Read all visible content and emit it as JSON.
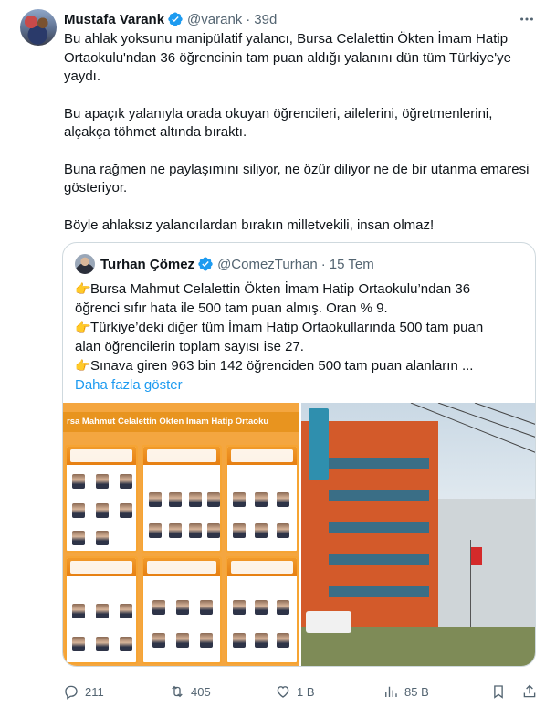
{
  "tweet": {
    "author_name": "Mustafa Varank",
    "handle": "@varank",
    "separator": "·",
    "time": "39d",
    "paragraphs": [
      "Bu ahlak yoksunu manipülatif yalancı,  Bursa Celalettin Ökten İmam Hatip Ortaokulu'ndan 36 öğrencinin tam puan aldığı yalanını dün tüm Türkiye'ye yaydı.",
      "Bu apaçık yalanıyla orada okuyan öğrencileri, ailelerini, öğretmenlerini, alçakça töhmet altında bıraktı.",
      "Buna rağmen ne paylaşımını siliyor, ne özür diliyor ne de bir utanma emaresi gösteriyor.",
      "Böyle ahlaksız yalancılardan bırakın milletvekili, insan olmaz!"
    ]
  },
  "quote": {
    "author_name": "Turhan Çömez",
    "handle": "@ComezTurhan",
    "separator": "·",
    "time": "15 Tem",
    "emoji": "👉",
    "lines": [
      {
        "emoji": true,
        "text": "Bursa Mahmut Celalettin Ökten İmam Hatip Ortaokulu’ndan 36"
      },
      {
        "emoji": false,
        "text": "öğrenci sıfır hata ile 500 tam puan almış. Oran % 9."
      },
      {
        "emoji": true,
        "text": "Türkiye’deki diğer tüm İmam Hatip Ortaokullarında 500 tam puan"
      },
      {
        "emoji": false,
        "text": "alan öğrencilerin toplam sayısı ise 27."
      },
      {
        "emoji": true,
        "text": "Sınava giren 963 bin 142 öğrenciden 500 tam puan alanların  ..."
      }
    ],
    "show_more": "Daha fazla göster",
    "media": {
      "left_banner": "rsa Mahmut Celalettin Ökten İmam Hatip Ortaoku",
      "left_alt_icon": "school-poster-image",
      "right_alt_icon": "school-building-photo"
    }
  },
  "actions": {
    "replies": "211",
    "reposts": "405",
    "likes": "1 B",
    "views": "85 B"
  },
  "colors": {
    "text": "#0f1419",
    "secondary": "#536471",
    "link": "#1d9bf0",
    "verified": "#1d9bf0",
    "border": "#cfd9de"
  }
}
